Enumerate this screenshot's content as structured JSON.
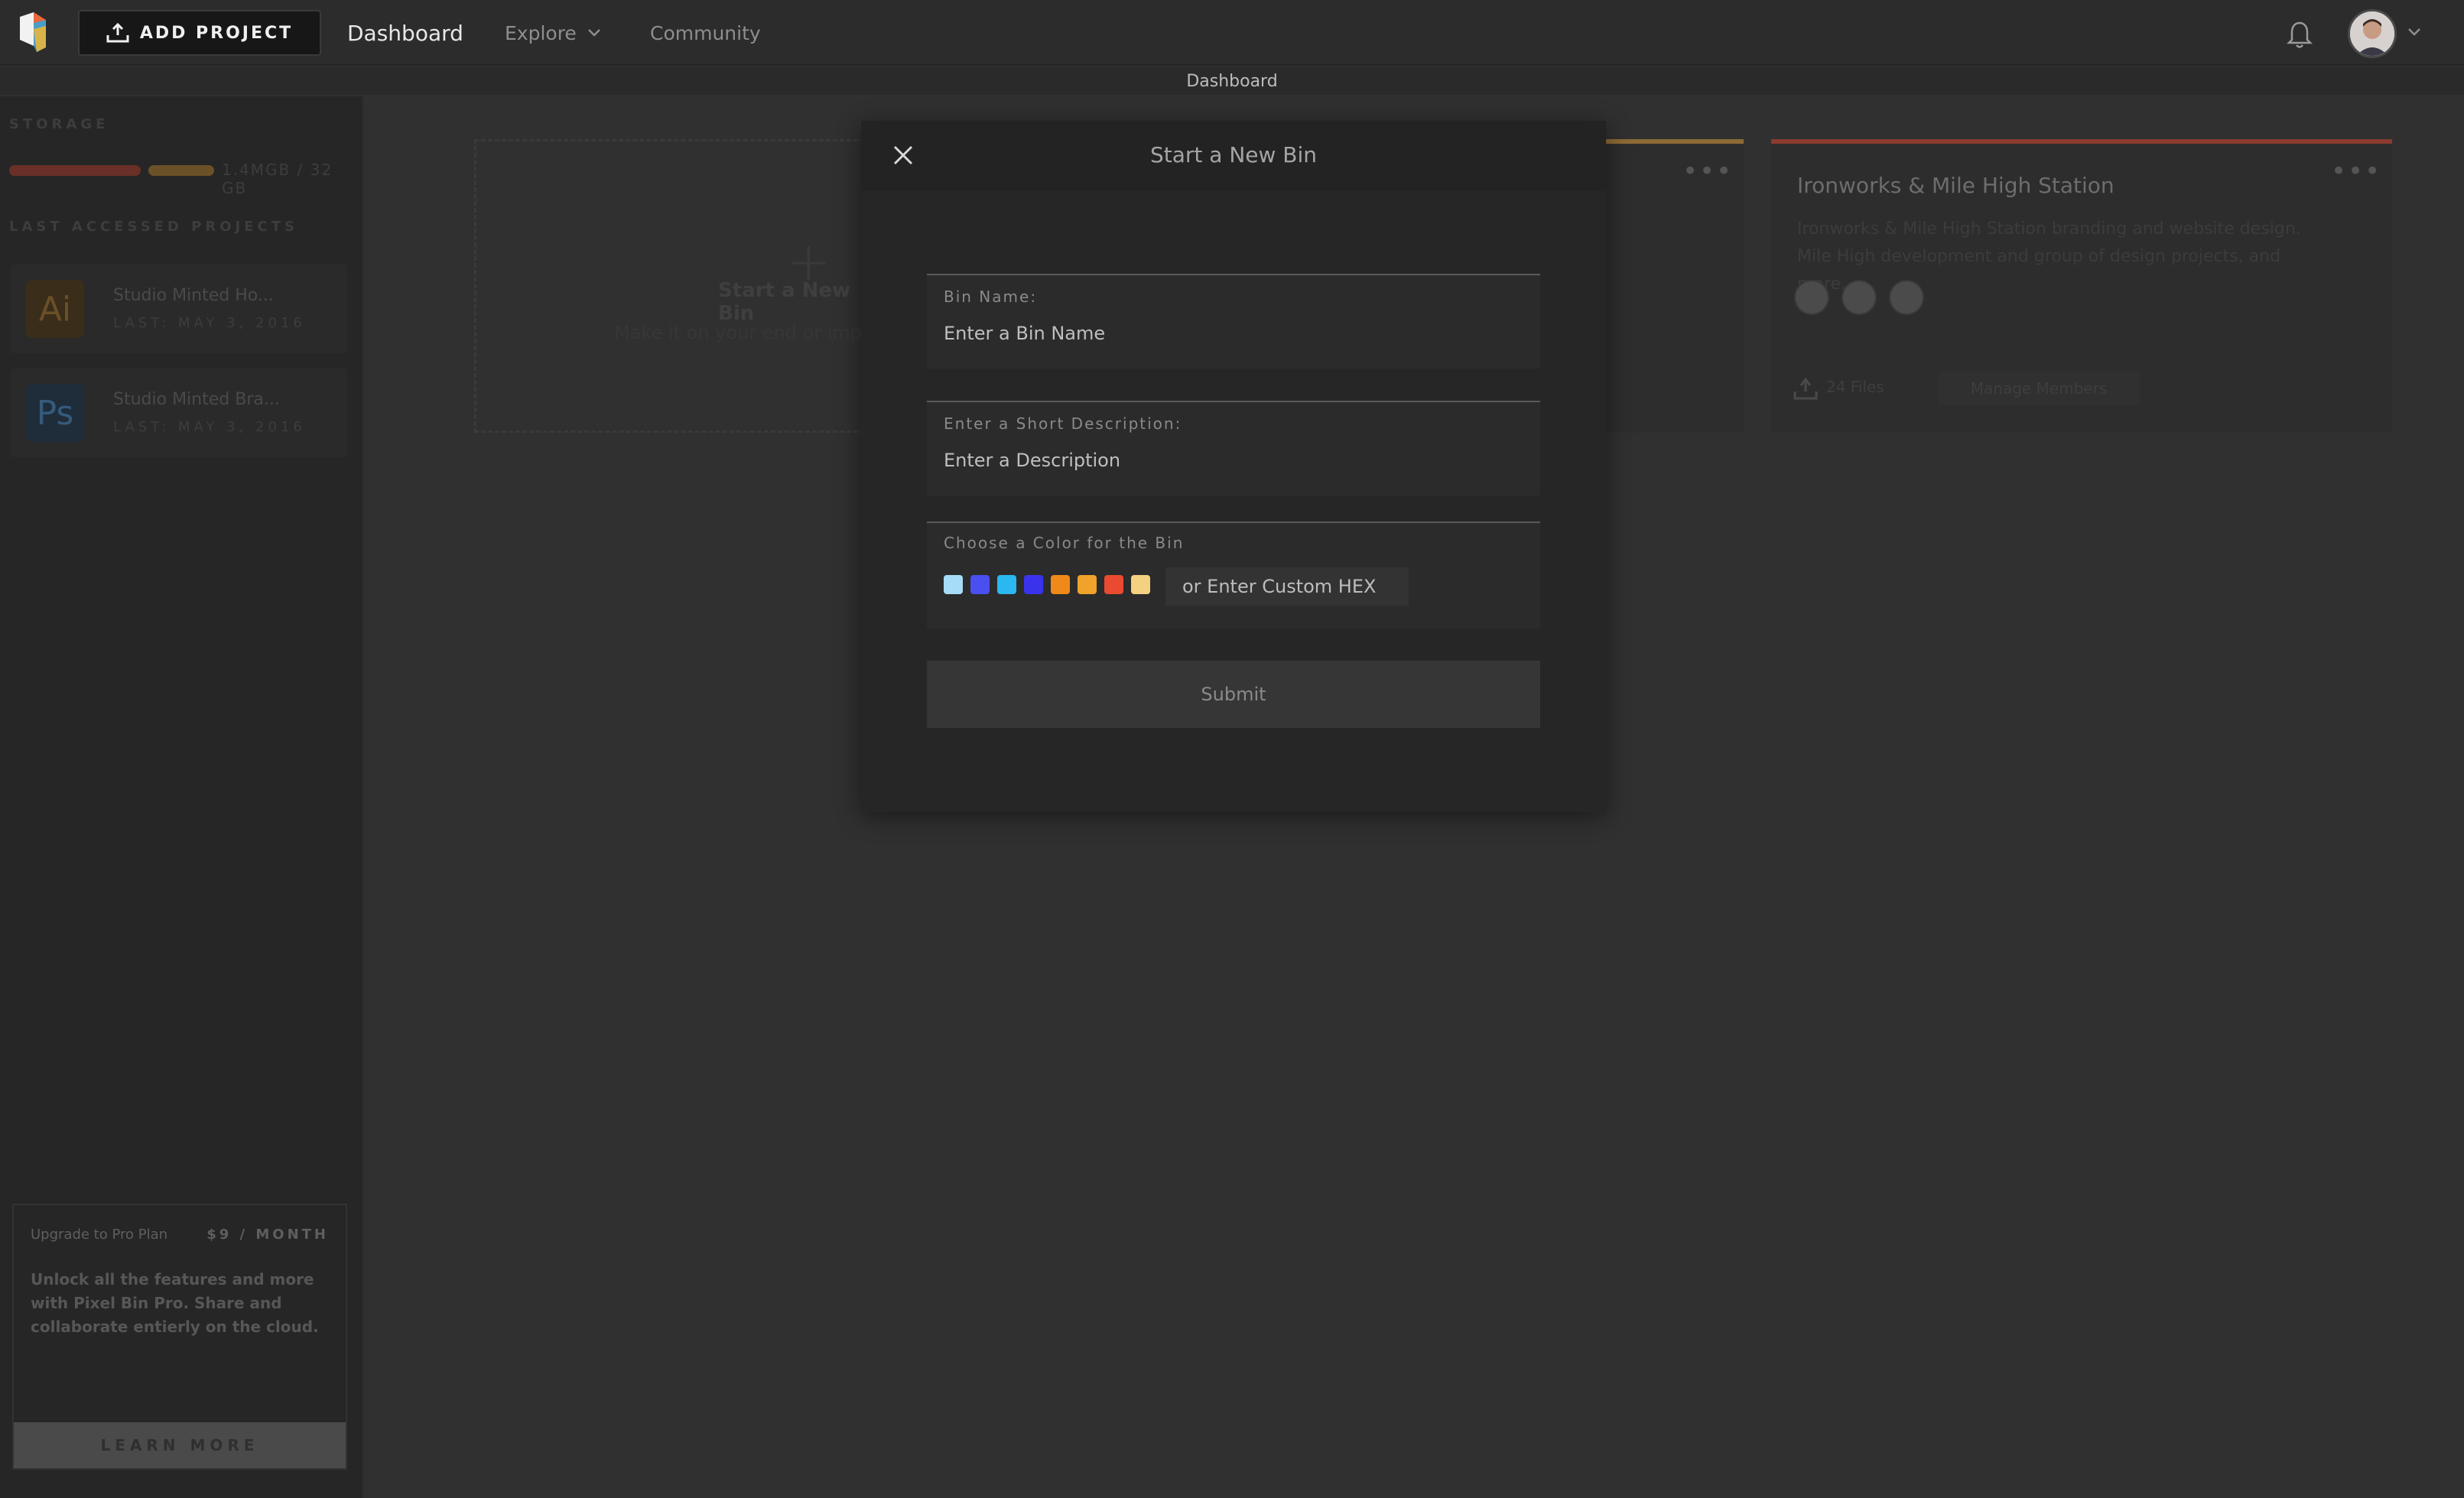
{
  "topbar": {
    "add_project_label": "ADD PROJECT",
    "nav_dashboard": "Dashboard",
    "nav_explore": "Explore",
    "nav_community": "Community"
  },
  "subheader": {
    "title": "Dashboard"
  },
  "sidebar": {
    "storage_label": "STORAGE",
    "storage_text": "1.4MGB / 32 GB",
    "storage_colors": [
      "#8a3b2f",
      "#8d6a35"
    ],
    "recent_label": "LAST ACCESSED PROJECTS",
    "projects": [
      {
        "icon": "Ai",
        "name": "Studio Minted Ho...",
        "date": "LAST: MAY 3, 2016"
      },
      {
        "icon": "Ps",
        "name": "Studio Minted Bra...",
        "date": "LAST: MAY 3, 2016"
      }
    ],
    "upgrade": {
      "title": "Upgrade to Pro Plan",
      "price": "$9 / MONTH",
      "description": "Unlock all the features and more with Pixel Bin Pro. Share and collaborate entierly on the cloud.",
      "cta": "LEARN MORE"
    }
  },
  "main": {
    "new_bin_card": {
      "title": "Start a New Bin",
      "subtitle": "Make it on your end or import..."
    },
    "bin_card": {
      "title": "Ironworks & Mile High Station",
      "description": "Ironworks & Mile High Station branding and website design. Mile High development and group of design projects, and more.",
      "files": "24 Files",
      "manage_label": "Manage Members",
      "accent": "#8a3b2f"
    },
    "bin_card_mid_accent": "#8d6a35"
  },
  "modal": {
    "title": "Start a New Bin",
    "bin_name_label": "Bin Name:",
    "bin_name_placeholder": "Enter a Bin Name",
    "desc_label": "Enter a Short Description:",
    "desc_placeholder": "Enter a Description",
    "color_label": "Choose a Color for the Bin",
    "colors": [
      "#a6dcf7",
      "#4a4ff0",
      "#2bb7ef",
      "#3a33ee",
      "#ef8a1a",
      "#f0a22a",
      "#ea4a2f",
      "#f3d181"
    ],
    "hex_placeholder": "or Enter Custom HEX",
    "submit_label": "Submit"
  }
}
